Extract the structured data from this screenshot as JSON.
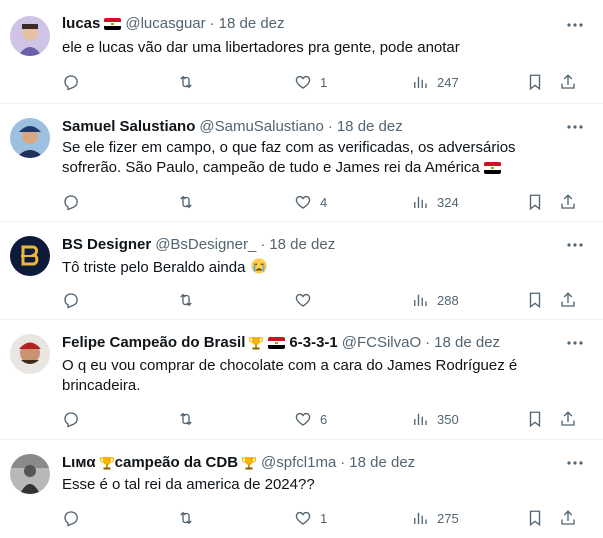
{
  "tweets": [
    {
      "name": "lucas",
      "handle": "@lucasguar",
      "dot": "·",
      "date": "18 de dez",
      "text": "ele e lucas vão dar uma libertadores pra gente, pode anotar",
      "replies": "",
      "retweets": "",
      "likes": "1",
      "views": "247"
    },
    {
      "name": "Samuel Salustiano",
      "handle": "@SamuSalustiano",
      "dot": "·",
      "date": "18 de dez",
      "text_line1": "Se ele fizer em campo, o que faz com as verificadas, os adversários",
      "text_line2": "sofrerão. São Paulo, campeão de tudo e James rei da América",
      "replies": "",
      "retweets": "",
      "likes": "4",
      "views": "324"
    },
    {
      "name": "BS Designer",
      "handle": "@BsDesigner_",
      "dot": "·",
      "date": "18 de dez",
      "text": "Tô triste pelo Beraldo ainda",
      "replies": "",
      "retweets": "",
      "likes": "",
      "views": "288"
    },
    {
      "name": "Felipe Campeão do Brasil",
      "name_suffix": "6-3-3-1",
      "handle": "@FCSilvaO",
      "dot": "·",
      "date": "18 de dez",
      "text_line1": "O q eu vou comprar de chocolate com a cara do James Rodríguez é",
      "text_line2": "brincadeira.",
      "replies": "",
      "retweets": "",
      "likes": "6",
      "views": "350"
    },
    {
      "name": "Lιмα",
      "name_suffix": "campeão da CDB",
      "handle": "@spfcl1ma",
      "dot": "·",
      "date": "18 de dez",
      "text": "Esse é o tal rei da america de 2024??",
      "replies": "",
      "retweets": "",
      "likes": "1",
      "views": "275"
    }
  ],
  "icons": {
    "more": "more-horizontal-icon",
    "reply": "reply-icon",
    "retweet": "retweet-icon",
    "like": "heart-icon",
    "views": "views-icon",
    "bookmark": "bookmark-icon",
    "share": "share-icon"
  },
  "colors": {
    "text": "#0f1419",
    "secondary": "#536471",
    "divider": "#eff3f4"
  }
}
